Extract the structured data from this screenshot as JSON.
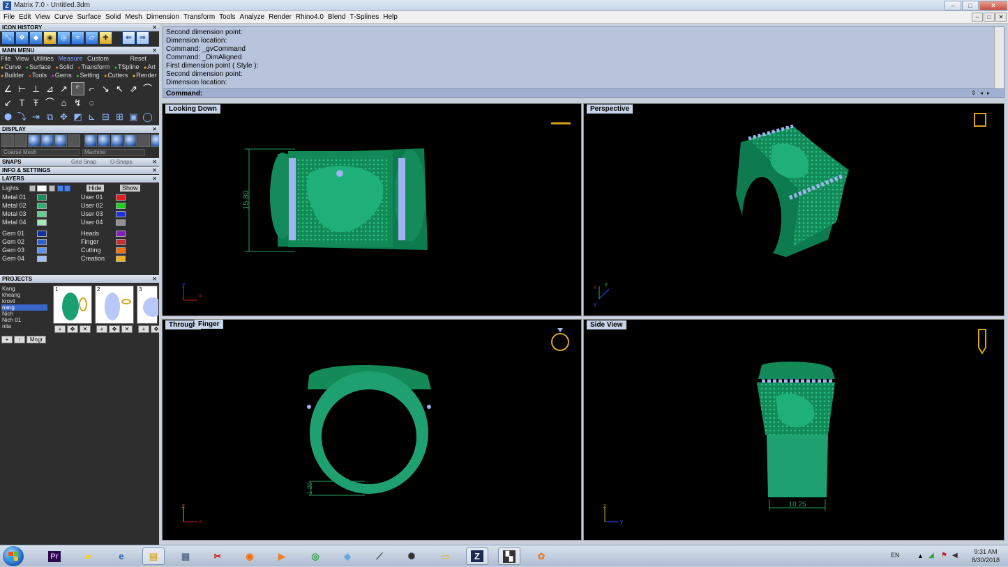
{
  "window": {
    "title": "Matrix 7.0 - Untitled.3dm",
    "minimize": "‒",
    "maximize": "□",
    "close": "✕"
  },
  "menubar": [
    "File",
    "Edit",
    "View",
    "Curve",
    "Surface",
    "Solid",
    "Mesh",
    "Dimension",
    "Transform",
    "Tools",
    "Analyze",
    "Render",
    "Rhino4.0",
    "Blend",
    "T-Splines",
    "Help"
  ],
  "left": {
    "icon_history": "ICON HISTORY",
    "main_menu": "MAIN MENU",
    "menu_tabs": [
      "File",
      "View",
      "Utilities",
      "Measure",
      "Custom"
    ],
    "menu_reset": "Reset",
    "cat_row1": [
      "Curve",
      "Surface",
      "Solid",
      "Transform",
      "TSpline",
      "Art"
    ],
    "cat_row2": [
      "Builder",
      "Tools",
      "Gems",
      "Setting",
      "Cutters",
      "Render"
    ],
    "display": "DISPLAY",
    "display_mesh": "Coarse Mesh",
    "display_mode": "Machine",
    "snaps": "SNAPS",
    "grid_snap": "Grid Snap",
    "o_snaps": "O-Snaps",
    "info_settings": "INFO & SETTINGS",
    "layers": "LAYERS",
    "lights": "Lights",
    "hide": "Hide",
    "show": "Show",
    "layers_left": [
      "Metal 01",
      "Metal 02",
      "Metal 03",
      "Metal 04"
    ],
    "layers_right": [
      "User 01",
      "User 02",
      "User 03",
      "User 04"
    ],
    "gems_left": [
      "Gem 01",
      "Gem 02",
      "Gem 03",
      "Gem 04"
    ],
    "gems_right": [
      "Heads",
      "Finger",
      "Cutting",
      "Creation"
    ],
    "projects": "PROJECTS",
    "project_list": [
      "Kang",
      "kheang",
      "krovil",
      "nang",
      "Nich",
      "Nich 01",
      "nita"
    ],
    "thumb_nums": [
      "1",
      "2",
      "3"
    ],
    "thumb_btn_add": "+",
    "thumb_btn_del": "✕",
    "mngr": "Mngr"
  },
  "command": {
    "history": [
      "Second dimension point:",
      "Dimension location:",
      "Command: _gvCommand",
      "Command: _DimAligned",
      "First dimension point ( Style ):",
      "Second dimension point:",
      "Dimension location:"
    ],
    "prompt": "Command:"
  },
  "viewports": {
    "top": "Looking Down",
    "perspective": "Perspective",
    "front_a": "Through",
    "front_b": "Finger",
    "side": "Side View"
  },
  "dimensions": {
    "top": "15.80",
    "front": "1.20",
    "side": "10.25"
  },
  "axes": {
    "x": "x",
    "y": "y",
    "z": "z"
  },
  "taskbar": {
    "language": "EN",
    "time": "9:31 AM",
    "date": "8/30/2018",
    "premiere": "Pr"
  },
  "colors": {
    "ring_green": "#1fa070",
    "gem_blue": "#9fb4f0",
    "dim_green": "#22a060",
    "viewport_bg": "#000000"
  }
}
